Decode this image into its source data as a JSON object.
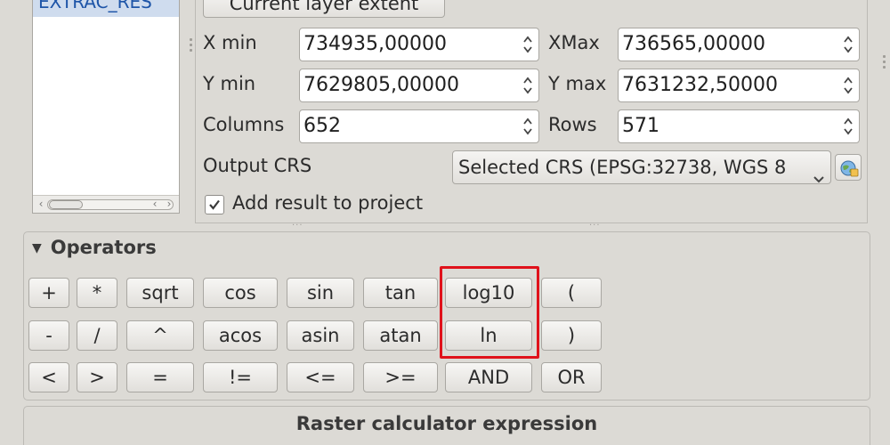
{
  "layer_list": {
    "items": [
      "EXTRAC_RES"
    ]
  },
  "result_layer": {
    "extent_button_label": "Current layer extent",
    "xmin_label": "X min",
    "xmin_value": "734935,00000",
    "xmax_label": "XMax",
    "xmax_value": "736565,00000",
    "ymin_label": "Y min",
    "ymin_value": "7629805,00000",
    "ymax_label": "Y max",
    "ymax_value": "7631232,50000",
    "columns_label": "Columns",
    "columns_value": "652",
    "rows_label": "Rows",
    "rows_value": "571",
    "output_crs_label": "Output CRS",
    "output_crs_value": "Selected CRS (EPSG:32738, WGS 8",
    "add_result_label": "Add result to project",
    "add_result_checked": true
  },
  "operators": {
    "title": "Operators",
    "row1": [
      "+",
      "*",
      "sqrt",
      "cos",
      "sin",
      "tan",
      "log10",
      "("
    ],
    "row2": [
      "-",
      "/",
      "^",
      "acos",
      "asin",
      "atan",
      "ln",
      ")"
    ],
    "row3": [
      "<",
      ">",
      "=",
      "!=",
      "<=",
      ">=",
      "AND",
      "OR"
    ]
  },
  "expression": {
    "title": "Raster calculator expression"
  },
  "colors": {
    "highlight": "#e0121b",
    "selection_text": "#1e55a8"
  }
}
